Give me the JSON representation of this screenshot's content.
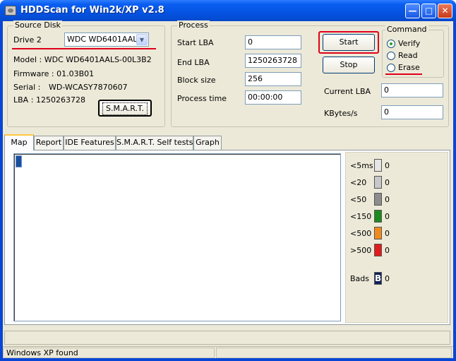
{
  "window": {
    "title": "HDDScan for Win2k/XP  v2.8"
  },
  "source_disk": {
    "legend": "Source Disk",
    "drive_label": "Drive  2",
    "drive_value": "WDC WD6401AAL",
    "model": "Model : WDC WD6401AALS-00L3B2",
    "firmware": "Firmware : 01.03B01",
    "serial_label": "Serial :",
    "serial_value": "WD-WCASY7870607",
    "lba_label": "LBA :",
    "lba_value": "1250263728",
    "smart_button": "S.M.A.R.T."
  },
  "process": {
    "legend": "Process",
    "start_lba_label": "Start LBA",
    "start_lba": "0",
    "end_lba_label": "End LBA",
    "end_lba": "1250263728",
    "block_size_label": "Block size",
    "block_size": "256",
    "process_time_label": "Process time",
    "process_time": "00:00:00",
    "start_button": "Start",
    "stop_button": "Stop",
    "current_lba_label": "Current LBA",
    "current_lba": "0",
    "kbytes_label": "KBytes/s",
    "kbytes": "0"
  },
  "command": {
    "legend": "Command",
    "options": [
      "Verify",
      "Read",
      "Erase"
    ],
    "selected": "Verify"
  },
  "tabs": [
    "Map",
    "Report",
    "IDE Features",
    "S.M.A.R.T. Self tests",
    "Graph"
  ],
  "active_tab": "Map",
  "legend_rows": [
    {
      "label": "<5ms",
      "color": "#e6e6e6",
      "count": "0"
    },
    {
      "label": "<20",
      "color": "#c8c8c8",
      "count": "0"
    },
    {
      "label": "<50",
      "color": "#8c8c8c",
      "count": "0"
    },
    {
      "label": "<150",
      "color": "#1c8a1c",
      "count": "0"
    },
    {
      "label": "<500",
      "color": "#f08a1c",
      "count": "0"
    },
    {
      "label": ">500",
      "color": "#e01c1c",
      "count": "0"
    }
  ],
  "bads": {
    "label": "Bads",
    "glyph": "B",
    "color": "#10205a",
    "count": "0"
  },
  "status": {
    "text": "Windows XP found"
  }
}
